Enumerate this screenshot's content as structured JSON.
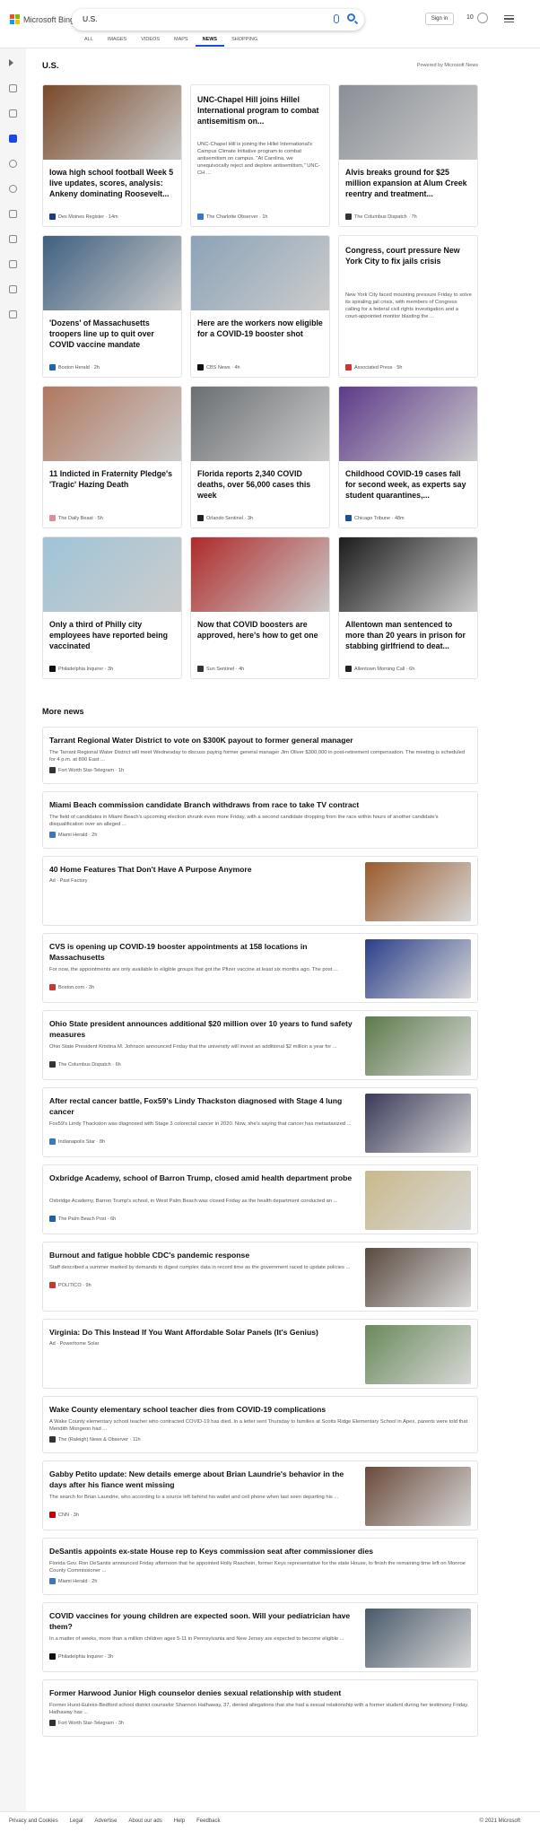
{
  "header": {
    "brand": "Microsoft Bing",
    "query": "U.S.",
    "signin": "Sign in",
    "rewards": "10",
    "scopes": [
      "ALL",
      "IMAGES",
      "VIDEOS",
      "MAPS",
      "NEWS",
      "SHOPPING"
    ],
    "active_scope": "NEWS"
  },
  "section": {
    "title": "U.S.",
    "powered_by": "Powered by Microsoft News"
  },
  "cards": [
    {
      "title": "Iowa high school football Week 5 live updates, scores, analysis: Ankeny dominating Roosevelt...",
      "source": "Des Moines Register · 14m",
      "desc": "",
      "img_color": "#7a4a2a",
      "icon_color": "#1e3a8a"
    },
    {
      "title": "UNC-Chapel Hill joins Hillel International program to combat antisemitism on...",
      "source": "The Charlotte Observer · 1h",
      "desc": "UNC-Chapel Hill is joining the Hillel International's Campus Climate Initiative program to combat antisemitism on campus. \"At Carolina, we unequivocally reject and deplore antisemitism,\" UNC-CH ...",
      "img_color": "",
      "icon_color": "#3a78c4"
    },
    {
      "title": "Alvis breaks ground for $25 million expansion at Alum Creek reentry and treatment...",
      "source": "The Columbus Dispatch · 7h",
      "desc": "",
      "img_color": "#8a8f96",
      "icon_color": "#333"
    },
    {
      "title": "'Dozens' of Massachusetts troopers line up to quit over COVID vaccine mandate",
      "source": "Boston Herald · 2h",
      "desc": "",
      "img_color": "#3f6080",
      "icon_color": "#2266aa"
    },
    {
      "title": "Here are the workers now eligible for a COVID-19 booster shot",
      "source": "CBS News · 4h",
      "desc": "",
      "img_color": "#8ca3b8",
      "icon_color": "#111"
    },
    {
      "title": "Congress, court pressure New York City to fix jails crisis",
      "source": "Associated Press · 5h",
      "desc": "New York City faced mounting pressure Friday to solve its spiraling jail crisis, with members of Congress calling for a federal civil rights investigation and a court-appointed monitor blasting the ...",
      "img_color": "",
      "icon_color": "#d0342c"
    },
    {
      "title": "11 Indicted in Fraternity Pledge's 'Tragic' Hazing Death",
      "source": "The Daily Beast · 5h",
      "desc": "",
      "img_color": "#b07860",
      "icon_color": "#e08c9a"
    },
    {
      "title": "Florida reports 2,340 COVID deaths, over 56,000 cases this week",
      "source": "Orlando Sentinel · 3h",
      "desc": "",
      "img_color": "#6b6f72",
      "icon_color": "#222"
    },
    {
      "title": "Childhood COVID-19 cases fall for second week, as experts say student quarantines,...",
      "source": "Chicago Tribune · 48m",
      "desc": "",
      "img_color": "#5d3a8a",
      "icon_color": "#1a4ea0"
    },
    {
      "title": "Only a third of Philly city employees have reported being vaccinated",
      "source": "Philadelphia Inquirer · 3h",
      "desc": "",
      "img_color": "#9fc4d8",
      "icon_color": "#111"
    },
    {
      "title": "Now that COVID boosters are approved, here's how to get one",
      "source": "Sun Sentinel · 4h",
      "desc": "",
      "img_color": "#b02a2a",
      "icon_color": "#333"
    },
    {
      "title": "Allentown man sentenced to more than 20 years in prison for stabbing girlfriend to deat...",
      "source": "Allentown Morning Call · 6h",
      "desc": "",
      "img_color": "#1c1c1c",
      "icon_color": "#222"
    }
  ],
  "more_news": {
    "title": "More news",
    "items": [
      {
        "title": "Tarrant Regional Water District to vote on $300K payout to former general manager",
        "desc": "The Tarrant Regional Water District will meet Wednesday to discuss paying former general manager Jim Oliver $300,000 in post-retirement compensation. The meeting is scheduled for 4 p.m. at 800 East ...",
        "source": "Fort Worth Star-Telegram · 1h",
        "img_color": "",
        "icon_color": "#333"
      },
      {
        "title": "Miami Beach commission candidate Branch withdraws from race to take TV contract",
        "desc": "The field of candidates in Miami Beach's upcoming election shrunk even more Friday, with a second candidate dropping from the race within hours of another candidate's disqualification over an alleged ...",
        "source": "Miami Herald · 2h",
        "img_color": "",
        "icon_color": "#3a78c4"
      },
      {
        "title": "40 Home Features That Don't Have A Purpose Anymore",
        "desc": "",
        "source": "Ad · Past Factory",
        "img_color": "#9a5a2c",
        "icon_color": ""
      },
      {
        "title": "CVS is opening up COVID-19 booster appointments at 158 locations in Massachusetts",
        "desc": "For now, the appointments are only available to eligible groups that got the Pfizer vaccine at least six months ago. The post ...",
        "source": "Boston.com · 3h",
        "img_color": "#2a3f8a",
        "icon_color": "#d0342c"
      },
      {
        "title": "Ohio State president announces additional $20 million over 10 years to fund safety measures",
        "desc": "Ohio State President Kristina M. Johnson announced Friday that the university will invest an additional $2 million a year for ...",
        "source": "The Columbus Dispatch · 6h",
        "img_color": "#5d7a4a",
        "icon_color": "#333"
      },
      {
        "title": "After rectal cancer battle, Fox59's Lindy Thackston diagnosed with Stage 4 lung cancer",
        "desc": "Fox59's Lindy Thackston was diagnosed with Stage 3 colorectal cancer in 2020. Now, she's saying that cancer has metastasized ...",
        "source": "Indianapolis Star · 8h",
        "img_color": "#3a3a5a",
        "icon_color": "#3a78c4"
      },
      {
        "title": "Oxbridge Academy, school of Barron Trump, closed amid health department probe",
        "desc": "Oxbridge Academy, Barron Trump's school, in West Palm Beach was closed Friday as the health department conducted an ...",
        "source": "The Palm Beach Post · 6h",
        "img_color": "#c9b98a",
        "icon_color": "#1e5fb4"
      },
      {
        "title": "Burnout and fatigue hobble CDC's pandemic response",
        "desc": "Staff described a summer marked by demands to digest complex data in record time as the government raced to update policies ...",
        "source": "POLITICO · 9h",
        "img_color": "#5a4a40",
        "icon_color": "#d0342c"
      },
      {
        "title": "Virginia: Do This Instead If You Want Affordable Solar Panels (It's Genius)",
        "desc": "",
        "source": "Ad · Powerhome Solar",
        "img_color": "#6a8a5a",
        "icon_color": ""
      },
      {
        "title": "Wake County elementary school teacher dies from COVID-19 complications",
        "desc": "A Wake County elementary school teacher who contracted COVID-19 has died. In a letter sent Thursday to families at Scotts Ridge Elementary School in Apex, parents were told that Meridith Mongeon had ...",
        "source": "The (Raleigh) News & Observer · 11h",
        "img_color": "",
        "icon_color": "#333"
      },
      {
        "title": "Gabby Petito update: New details emerge about Brian Laundrie's behavior in the days after his fiance went missing",
        "desc": "The search for Brian Laundrie, who according to a source left behind his wallet and cell phone when last seen departing his ...",
        "source": "CNN · 3h",
        "img_color": "#6a4a3a",
        "icon_color": "#cc0000"
      },
      {
        "title": "DeSantis appoints ex-state House rep to Keys commission seat after commissioner dies",
        "desc": "Florida Gov. Ron DeSantis announced Friday afternoon that he appointed Holly Raschein, former Keys representative for the state House, to finish the remaining time left on Monroe County Commissioner ...",
        "source": "Miami Herald · 2h",
        "img_color": "",
        "icon_color": "#3a78c4"
      },
      {
        "title": "COVID vaccines for young children are expected soon. Will your pediatrician have them?",
        "desc": "In a matter of weeks, more than a million children ages 5-11 in Pennsylvania and New Jersey are expected to become eligible ...",
        "source": "Philadelphia Inquirer · 3h",
        "img_color": "#4a5a6a",
        "icon_color": "#111"
      },
      {
        "title": "Former Harwood Junior High counselor denies sexual relationship with student",
        "desc": "Former Hurst-Euless-Bedford school district counselor Shannon Hathaway, 37, denied allegations that she had a sexual relationship with a former student during her testimony Friday. Hathaway has ...",
        "source": "Fort Worth Star-Telegram · 3h",
        "img_color": "",
        "icon_color": "#333"
      }
    ]
  },
  "footer": {
    "links": [
      "Privacy and Cookies",
      "Legal",
      "Advertise",
      "About our ads",
      "Help",
      "Feedback"
    ],
    "copyright": "© 2021 Microsoft"
  },
  "colors": {
    "accent": "#174ae4",
    "brand_red": "#f25022",
    "brand_green": "#7fba00",
    "brand_blue": "#00a4ef",
    "brand_yellow": "#ffb900"
  }
}
